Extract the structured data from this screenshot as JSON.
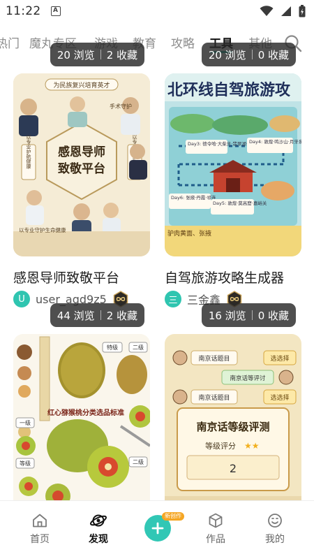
{
  "status_bar": {
    "time": "11:22",
    "notification_icon": "A"
  },
  "tabs": [
    {
      "label": "热门",
      "active": false
    },
    {
      "label": "魔丸专区",
      "active": false
    },
    {
      "label": "游戏",
      "active": false
    },
    {
      "label": "教育",
      "active": false
    },
    {
      "label": "攻略",
      "active": false
    },
    {
      "label": "工具",
      "active": true
    },
    {
      "label": "其他",
      "active": false
    }
  ],
  "colors": {
    "accent": "#2fc5b0",
    "fab": "#31c7b5",
    "badge": "#f5a623"
  },
  "cards": [
    {
      "title": "感恩导师致敬平台",
      "views": "20 浏览",
      "favorites": "2 收藏",
      "author": "user_agd9z5",
      "avatar_letter": "U",
      "avatar_color": "#2fc5b0",
      "thumb": {
        "heading": "感恩导师致敬平台",
        "top_banner": "为民族复兴培育英才",
        "left_label": "以专业护航健康",
        "right_label": "以专业守护生命",
        "mid_label": "手术守护",
        "footer": "以专业守护生命健康"
      }
    },
    {
      "title": "自驾旅游攻略生成器",
      "views": "20 浏览",
      "favorites": "0 收藏",
      "author": "三金鑫",
      "avatar_letter": "三",
      "avatar_color": "#2fc5b0",
      "thumb": {
        "heading": "北环线自驾旅游攻",
        "day3": "Day3: 德令哈·大柴旦·翡翠湖·敦煌",
        "day4": "Day4: 敦煌·鸣沙山·月牙泉",
        "day5": "Day5: 敦煌·莫高窟·嘉峪关",
        "day6": "Day6: 张掖·丹霞·祁连",
        "footer": "驴肉黄面、张掖"
      }
    },
    {
      "title": "",
      "views": "44 浏览",
      "favorites": "2 收藏",
      "thumb": {
        "heading": "红心猕猴桃分类选品标准",
        "grade_top": "特级",
        "grade_two": "二级",
        "grade_one": "一级",
        "grade_mid": "二级",
        "grade_low": "等级"
      }
    },
    {
      "title": "",
      "views": "16 浏览",
      "favorites": "0 收藏",
      "thumb": {
        "chat1": "南京话题目",
        "btn1": "选选择",
        "chat2": "南京话等评讨",
        "chat3": "南京话题目",
        "btn2": "选选择",
        "heading": "南京话等级评测",
        "rating_label": "等级评分",
        "score": "2"
      }
    }
  ],
  "bottom_nav": [
    {
      "label": "首页",
      "icon": "home-icon",
      "active": false
    },
    {
      "label": "发现",
      "icon": "planet-icon",
      "active": true
    },
    {
      "label": "",
      "icon": "plus-icon",
      "active": false
    },
    {
      "label": "作品",
      "icon": "cube-icon",
      "active": false
    },
    {
      "label": "我的",
      "icon": "smile-face-icon",
      "active": false
    }
  ],
  "fab_badge": "新创作"
}
